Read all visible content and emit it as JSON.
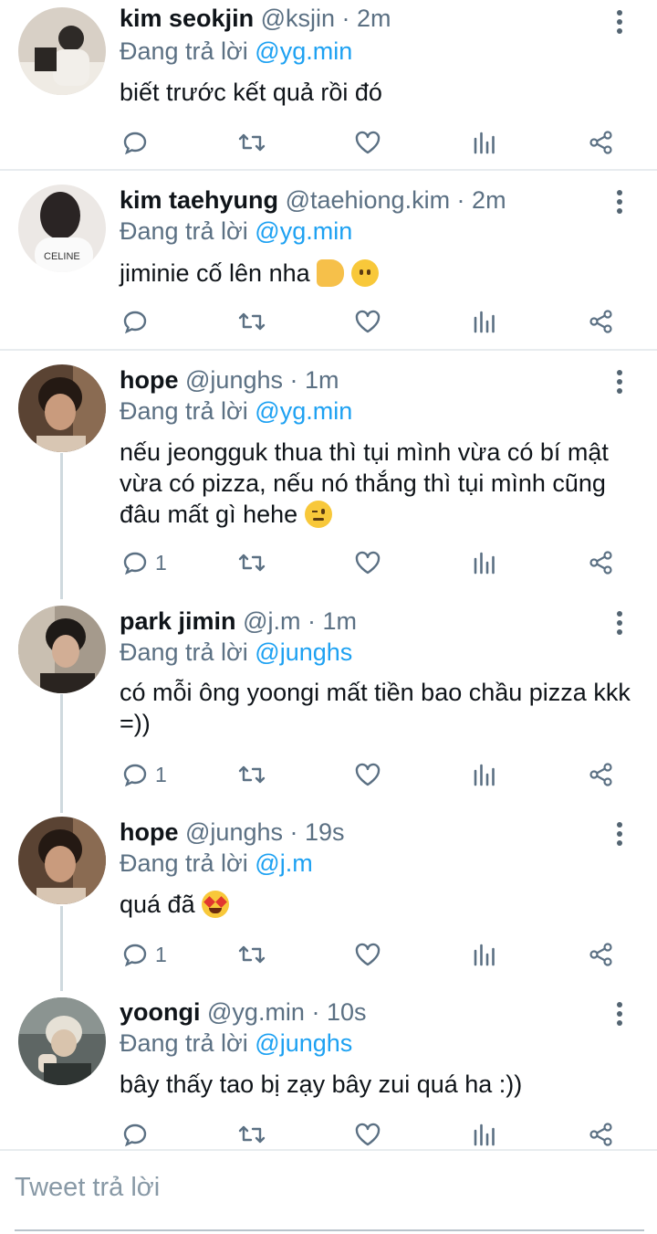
{
  "reply_prefix": "Đang trả lời",
  "tweets": [
    {
      "name": "kim seokjin",
      "meta": "@ksjin · 2m",
      "reply_to": "@yg.min",
      "text": "biết trước kết quả rồi đó",
      "emoji": [],
      "reply_count": "",
      "avatar_colors": [
        "#cfc6bb",
        "#3b3733",
        "#f1ede7"
      ]
    },
    {
      "name": "kim taehyung",
      "meta": "@taehiong.kim · 2m",
      "reply_to": "@yg.min",
      "text": "jiminie cố lên nha",
      "emoji": [
        "flexed-biceps-emoji",
        "neutral-face-emoji"
      ],
      "reply_count": "",
      "avatar_colors": [
        "#e9e6e4",
        "#2a2525",
        "#fafafa"
      ]
    },
    {
      "name": "hope",
      "meta": "@junghs · 1m",
      "reply_to": "@yg.min",
      "text": "nếu jeongguk thua thì tụi mình vừa có bí mật vừa có pizza, nếu nó thắng thì tụi mình cũng đâu mất gì hehe",
      "emoji": [
        "winking-face-emoji"
      ],
      "reply_count": "1",
      "avatar_colors": [
        "#6b5240",
        "#2a1e17",
        "#c79a7c"
      ]
    },
    {
      "name": "park jimin",
      "meta": "@j.m · 1m",
      "reply_to": "@junghs",
      "text": "có mỗi ông yoongi mất tiền bao chầu pizza kkk =))",
      "emoji": [],
      "reply_count": "1",
      "avatar_colors": [
        "#a79c8e",
        "#1d1a18",
        "#d4b29a"
      ]
    },
    {
      "name": "hope",
      "meta": "@junghs · 19s",
      "reply_to": "@j.m",
      "text": "quá đã",
      "emoji": [
        "star-struck-emoji"
      ],
      "reply_count": "1",
      "avatar_colors": [
        "#6b5240",
        "#2a1e17",
        "#c79a7c"
      ]
    },
    {
      "name": "yoongi",
      "meta": "@yg.min · 10s",
      "reply_to": "@junghs",
      "text": "bây thấy tao bị zạy bây zui quá ha :))",
      "emoji": [],
      "reply_count": "",
      "avatar_colors": [
        "#8a9390",
        "#3a3f3d",
        "#d9d4c9"
      ]
    }
  ],
  "compose": {
    "placeholder": "Tweet trả lời"
  },
  "colors": {
    "accent": "#1da1f2",
    "icon": "#5b7083",
    "text": "#0f1419"
  }
}
